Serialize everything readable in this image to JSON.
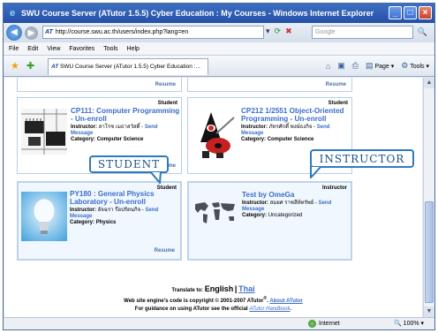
{
  "window": {
    "title": "SWU Course Server (ATutor 1.5.5) Cyber Education : My Courses - Windows Internet Explorer",
    "minimize": "_",
    "maximize": "□",
    "close": "×"
  },
  "address_bar": {
    "back": "◀",
    "forward": "▶",
    "site_icon": "AT",
    "url": "http://course.swu.ac.th/users/index.php?lang=en",
    "search_placeholder": "Google",
    "search_go": "🔍"
  },
  "menu": [
    "File",
    "Edit",
    "View",
    "Favorites",
    "Tools",
    "Help"
  ],
  "tab": {
    "icon": "AT",
    "label": "SWU Course Server (ATutor 1.5.5) Cyber Education :..."
  },
  "command_bar": {
    "page": "Page",
    "tools": "Tools"
  },
  "courses": [
    {
      "resume_top": "Resume",
      "role": "Student",
      "title": "CP111: Computer Programming - Un-enroll",
      "instructor_label": "Instructor:",
      "instructor": "สาโรช เมธาสวัสดิ์",
      "send_message": "Send Message",
      "category_label": "Category:",
      "category": "Computer Science",
      "resume": "Resume"
    },
    {
      "resume_top": "Resume",
      "role": "Student",
      "title": "CP212 1/2551 Object-Oriented Programming - Un-enroll",
      "instructor_label": "Instructor:",
      "instructor": "ภัทรศักดิ์ พงษ์ธงกิจ",
      "send_message": "Send Message",
      "category_label": "Category:",
      "category": "Computer Science",
      "resume": "Resume"
    },
    {
      "role": "Student",
      "title": "PY180 : General Physics Laboratory - Un-enroll",
      "instructor_label": "Instructor:",
      "instructor": "อัจฉรา ร๊อปรัตนกิจ",
      "send_message": "Send Message",
      "category_label": "Category:",
      "category": "Physics",
      "resume": "Resume"
    },
    {
      "role": "Instructor",
      "title": "Test by OmeGa",
      "instructor_label": "Instructor:",
      "instructor": "สมยศ ราชสีห์ทรัพย์",
      "send_message": "Send Message",
      "category_label": "Category:",
      "category": "Uncategorized"
    }
  ],
  "callouts": {
    "student": "STUDENT",
    "instructor": "INSTRUCTOR"
  },
  "footer": {
    "translate_label": "Translate to:",
    "english": "English",
    "separator": "|",
    "thai": "Thai",
    "copyright": "Web site engine's code is copyright © 2001-2007",
    "atutor_mark": "ATutor",
    "about_link": "About ATutor",
    "guidance_prefix": "For guidance on using ATutor see the official",
    "handbook_link": "ATutor Handbook",
    "guidance_suffix": "."
  },
  "status": {
    "zone": "Internet",
    "zoom": "100%"
  }
}
